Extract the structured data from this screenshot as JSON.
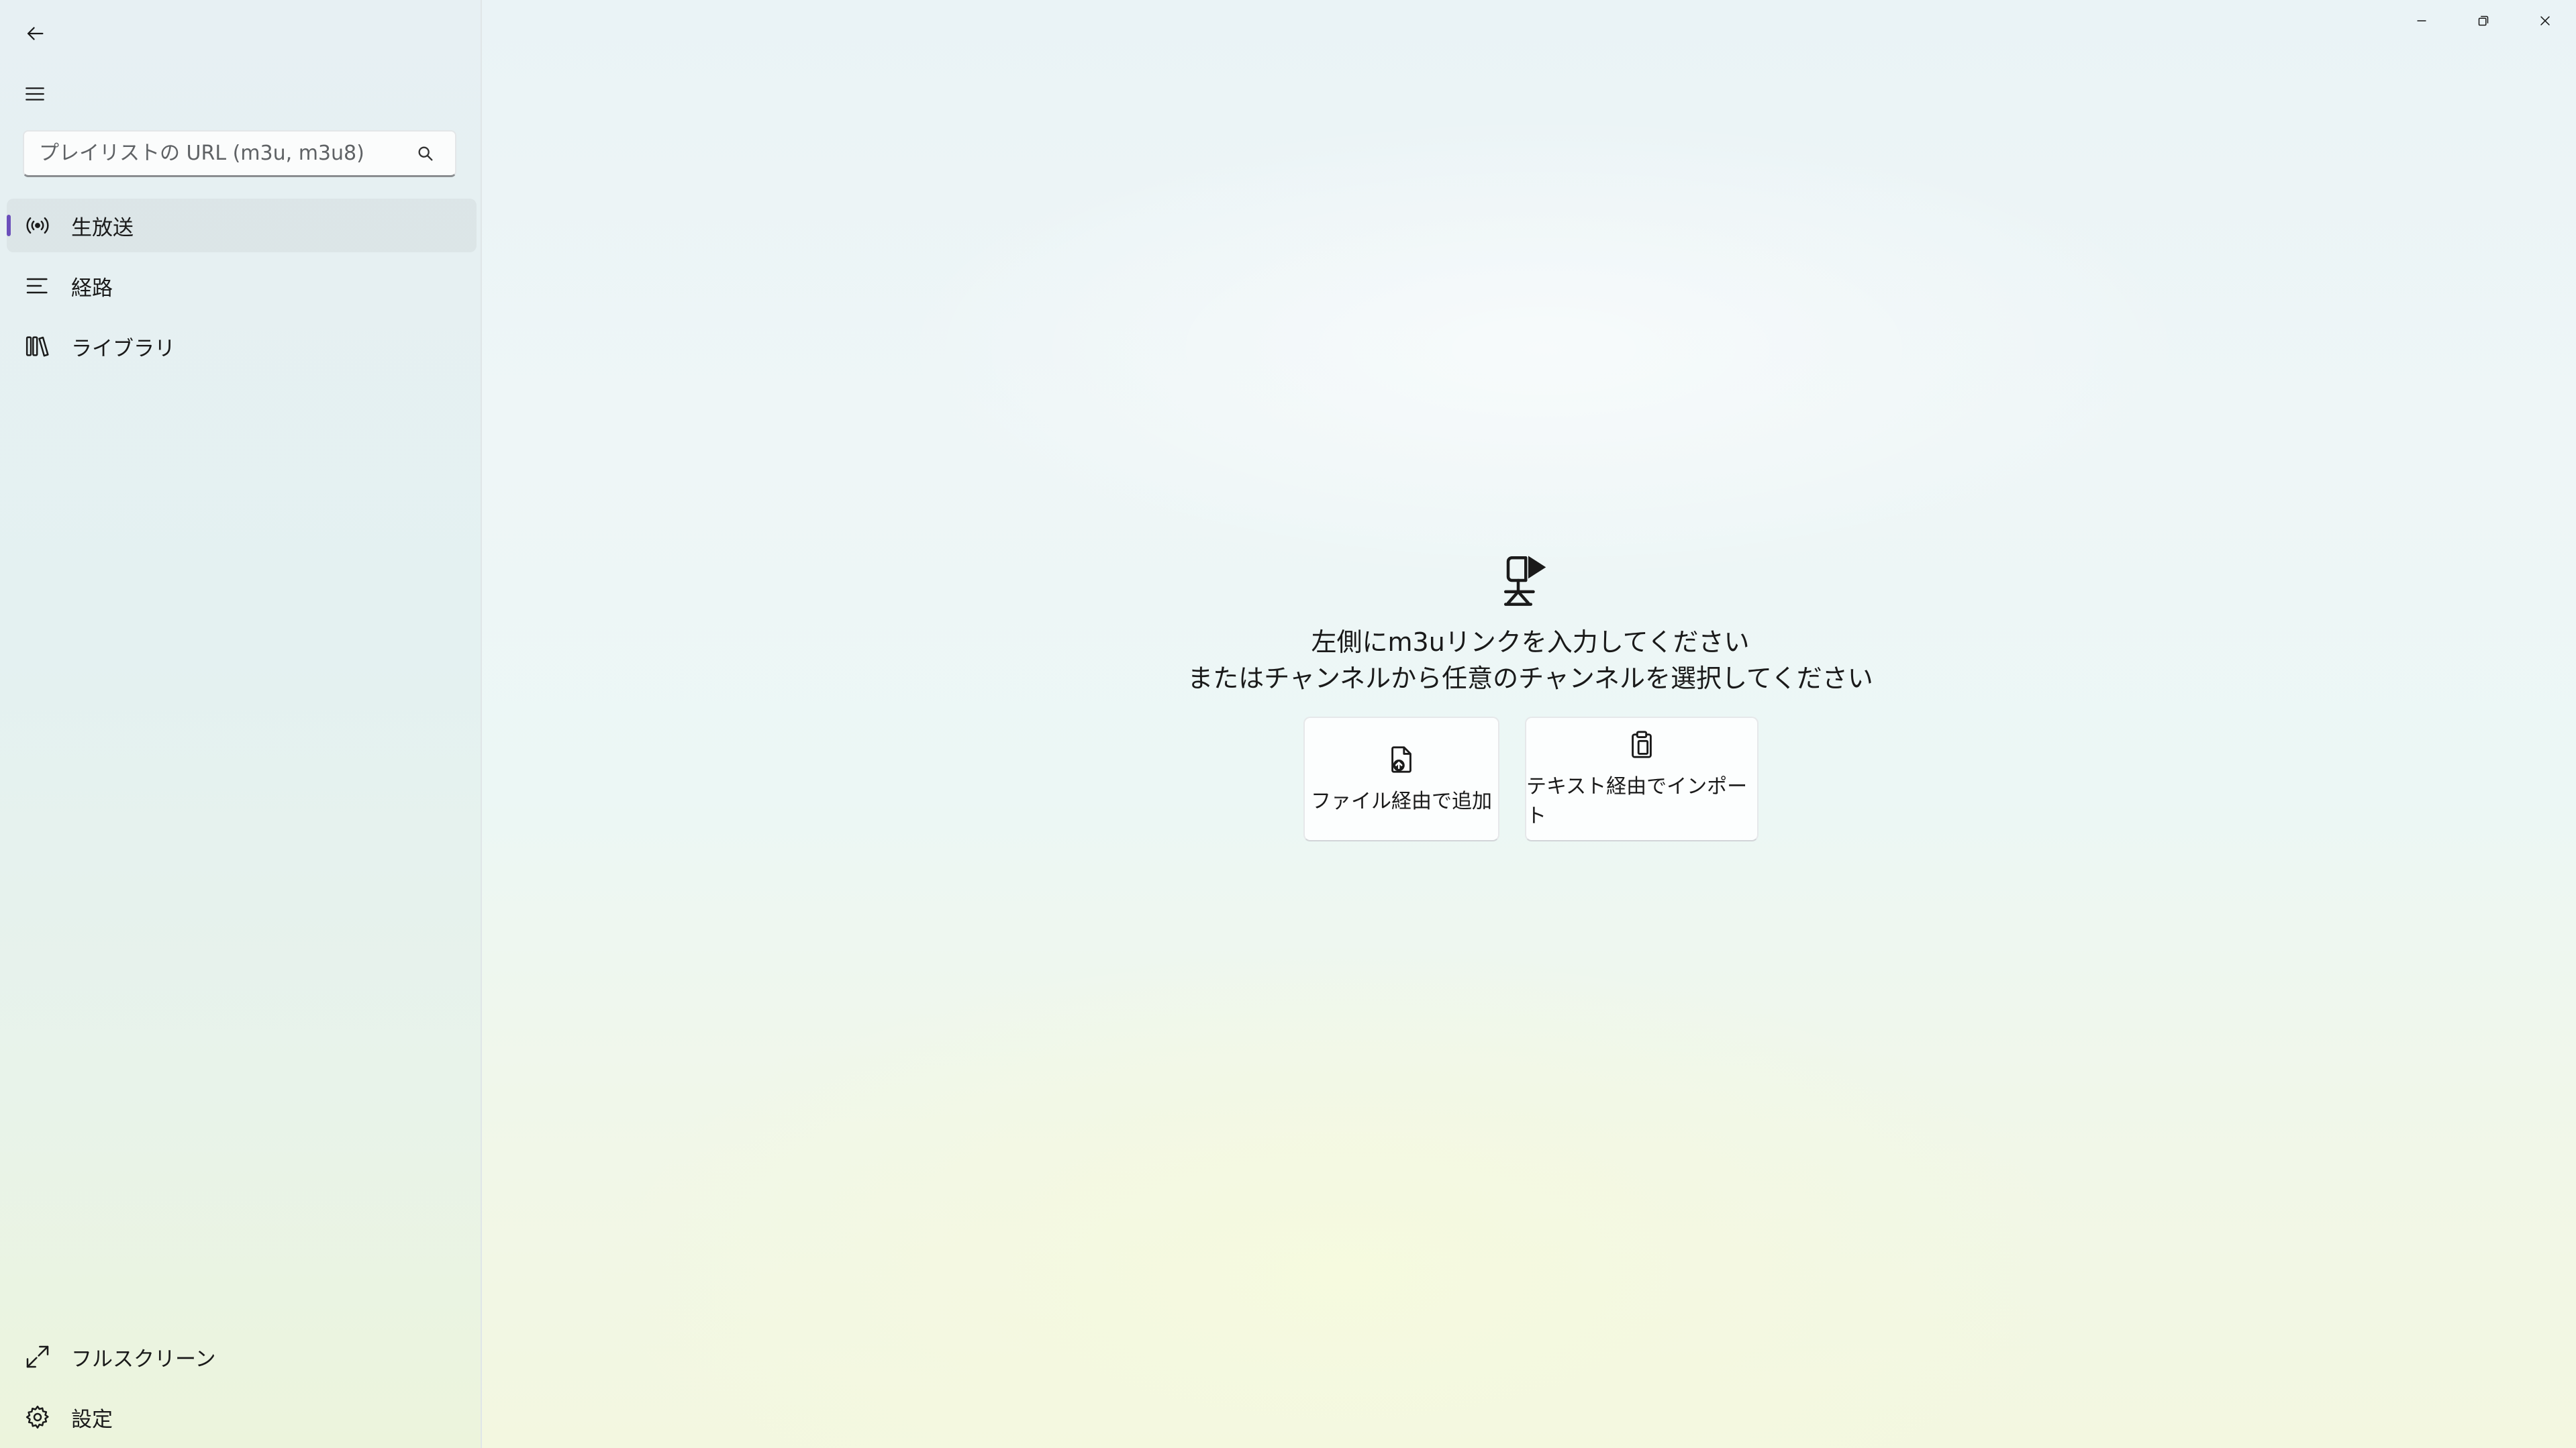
{
  "sidebar": {
    "search": {
      "placeholder": "プレイリストの URL (m3u, m3u8)",
      "value": ""
    },
    "nav_items": [
      {
        "label": "生放送",
        "icon": "live-broadcast-icon",
        "selected": true
      },
      {
        "label": "経路",
        "icon": "list-lines-icon",
        "selected": false
      },
      {
        "label": "ライブラリ",
        "icon": "library-icon",
        "selected": false
      }
    ],
    "footer_items": [
      {
        "label": "フルスクリーン",
        "icon": "fullscreen-icon"
      },
      {
        "label": "設定",
        "icon": "gear-icon"
      }
    ]
  },
  "main": {
    "empty_state": {
      "icon": "tv-play-icon",
      "line1": "左側にm3uリンクを入力してください",
      "line2": "またはチャンネルから任意のチャンネルを選択してください"
    },
    "actions": [
      {
        "label": "ファイル経由で追加",
        "icon": "add-file-icon"
      },
      {
        "label": "テキスト経由でインポート",
        "icon": "clipboard-icon"
      }
    ]
  },
  "colors": {
    "accent": "#6b4fbb",
    "selected_bg": "#e2ebee"
  }
}
